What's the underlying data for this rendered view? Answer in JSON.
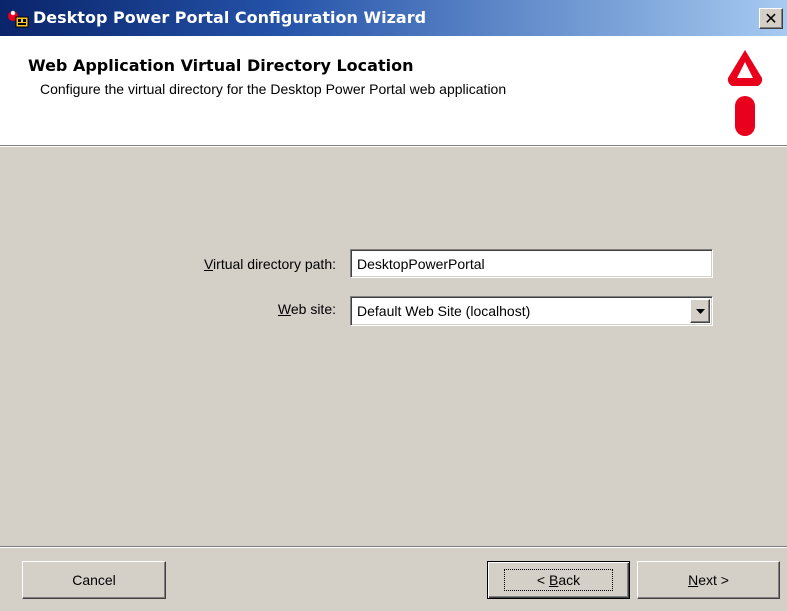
{
  "window": {
    "title": "Desktop Power Portal Configuration Wizard",
    "close_glyph": "✕"
  },
  "header": {
    "title": "Web Application Virtual Directory Location",
    "subtitle": "Configure the virtual directory for the Desktop Power Portal web application",
    "logo_icon": "red-exclamation-logo-icon",
    "logo_color": "#e8001c"
  },
  "form": {
    "vdir": {
      "label_mnemonic": "V",
      "label_rest": "irtual directory path:",
      "value": "DesktopPowerPortal"
    },
    "site": {
      "label_mnemonic": "W",
      "label_rest": "eb site:",
      "value": "Default Web Site (localhost)",
      "dropdown_icon": "chevron-down-icon"
    }
  },
  "buttons": {
    "cancel": "Cancel",
    "back_mnemonic": "B",
    "back_prefix": "< ",
    "back_rest": "ack",
    "next_mnemonic": "N",
    "next_rest": "ext >"
  },
  "colors": {
    "title_gradient_start": "#0a246a",
    "title_gradient_end": "#a6caf0",
    "dialog_face": "#d4d0c8"
  }
}
